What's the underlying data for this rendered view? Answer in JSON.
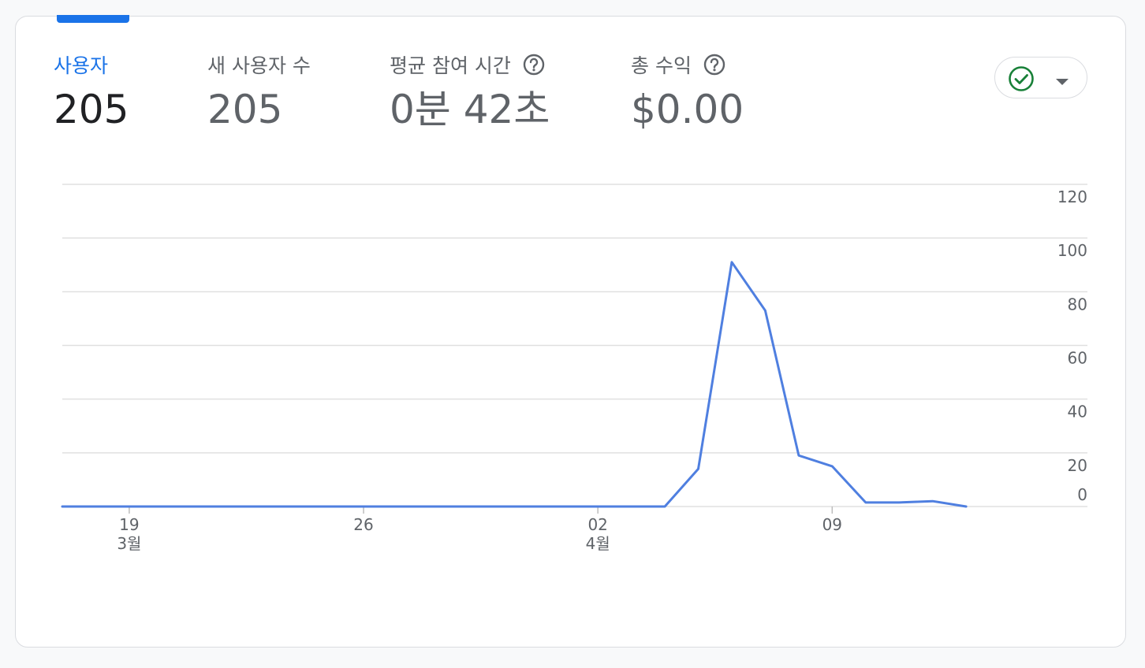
{
  "metrics": [
    {
      "label": "사용자",
      "value": "205",
      "active": true,
      "has_help": false
    },
    {
      "label": "새 사용자 수",
      "value": "205",
      "active": false,
      "has_help": false
    },
    {
      "label": "평균 참여 시간",
      "value": "0분 42초",
      "active": false,
      "has_help": true
    },
    {
      "label": "총 수익",
      "value": "$0.00",
      "active": false,
      "has_help": true
    }
  ],
  "status_button": {
    "icon": "check-circle-icon",
    "dropdown_icon": "caret-down-icon",
    "status_color": "#188038"
  },
  "colors": {
    "accent": "#1a73e8",
    "line": "#4f7fe0",
    "grid": "#e0e0e0"
  },
  "chart_data": {
    "type": "line",
    "x": [
      "03-17",
      "03-18",
      "03-19",
      "03-20",
      "03-21",
      "03-22",
      "03-23",
      "03-24",
      "03-25",
      "03-26",
      "03-27",
      "03-28",
      "03-29",
      "03-30",
      "03-31",
      "04-01",
      "04-02",
      "04-03",
      "04-04",
      "04-05",
      "04-06",
      "04-07",
      "04-08",
      "04-09",
      "04-10",
      "04-11",
      "04-12",
      "04-13",
      "04-14",
      "04-15"
    ],
    "series": [
      {
        "values": [
          0,
          0,
          0,
          0,
          0,
          0,
          0,
          0,
          0,
          0,
          0,
          0,
          0,
          0,
          0,
          0,
          0,
          0,
          0,
          14,
          91,
          73,
          19,
          15,
          1.5,
          1.5,
          2,
          0
        ]
      }
    ],
    "ylim": [
      0,
      120
    ],
    "yticks": [
      "120",
      "100",
      "80",
      "60",
      "40",
      "20",
      "0"
    ],
    "xticks": [
      {
        "x": "03-19",
        "label": "19",
        "sublabel": "3월"
      },
      {
        "x": "03-26",
        "label": "26",
        "sublabel": ""
      },
      {
        "x": "04-02",
        "label": "02",
        "sublabel": "4월"
      },
      {
        "x": "04-09",
        "label": "09",
        "sublabel": ""
      }
    ],
    "grid": true,
    "xlabel": "",
    "ylabel": ""
  }
}
